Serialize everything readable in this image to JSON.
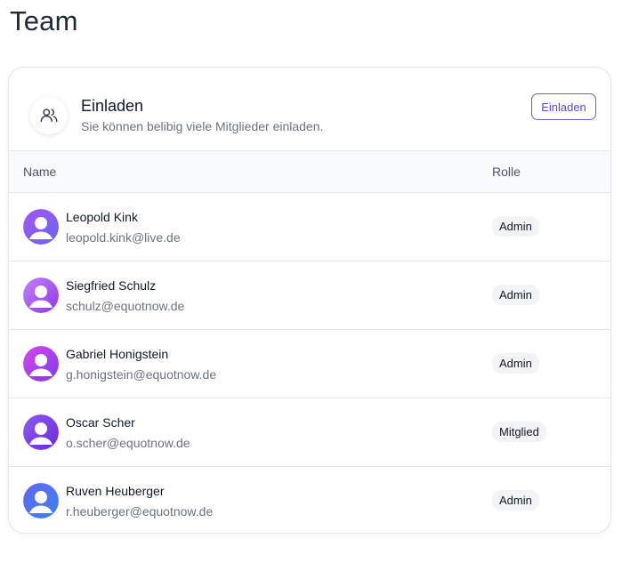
{
  "page": {
    "title": "Team"
  },
  "invite": {
    "title": "Einladen",
    "subtitle": "Sie können belibig viele Mitglieder einladen.",
    "button_label": "Einladen",
    "icon": "users-icon"
  },
  "table": {
    "columns": {
      "name": "Name",
      "role": "Rolle"
    },
    "rows": [
      {
        "name": "Leopold Kink",
        "email": "leopold.kink@live.de",
        "role": "Admin",
        "avatar_from": "#a855f7",
        "avatar_to": "#6366f1"
      },
      {
        "name": "Siegfried Schulz",
        "email": "schulz@equotnow.de",
        "role": "Admin",
        "avatar_from": "#c084fc",
        "avatar_to": "#9333ea"
      },
      {
        "name": "Gabriel Honigstein",
        "email": "g.honigstein@equotnow.de",
        "role": "Admin",
        "avatar_from": "#d946ef",
        "avatar_to": "#7c3aed"
      },
      {
        "name": "Oscar Scher",
        "email": "o.scher@equotnow.de",
        "role": "Mitglied",
        "avatar_from": "#8b5cf6",
        "avatar_to": "#6d28d9"
      },
      {
        "name": "Ruven Heuberger",
        "email": "r.heuberger@equotnow.de",
        "role": "Admin",
        "avatar_from": "#6366f1",
        "avatar_to": "#3b82f6"
      }
    ]
  },
  "colors": {
    "accent": "#5b4bc8",
    "border": "#e5e7eb",
    "muted_text": "#6b7280"
  }
}
